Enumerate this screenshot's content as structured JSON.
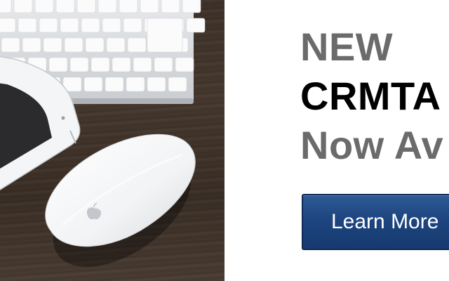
{
  "banner": {
    "headline_line1": "NEW",
    "headline_line2": "CRMTA",
    "headline_line3": "Now Av",
    "cta_label": "Learn More"
  },
  "colors": {
    "grey_text": "#6b6b6b",
    "black_text": "#000000",
    "button_blue": "#1d4580",
    "desk_wood": "#3e3229"
  },
  "icons": {
    "mouse_logo": "apple-logo-icon"
  }
}
